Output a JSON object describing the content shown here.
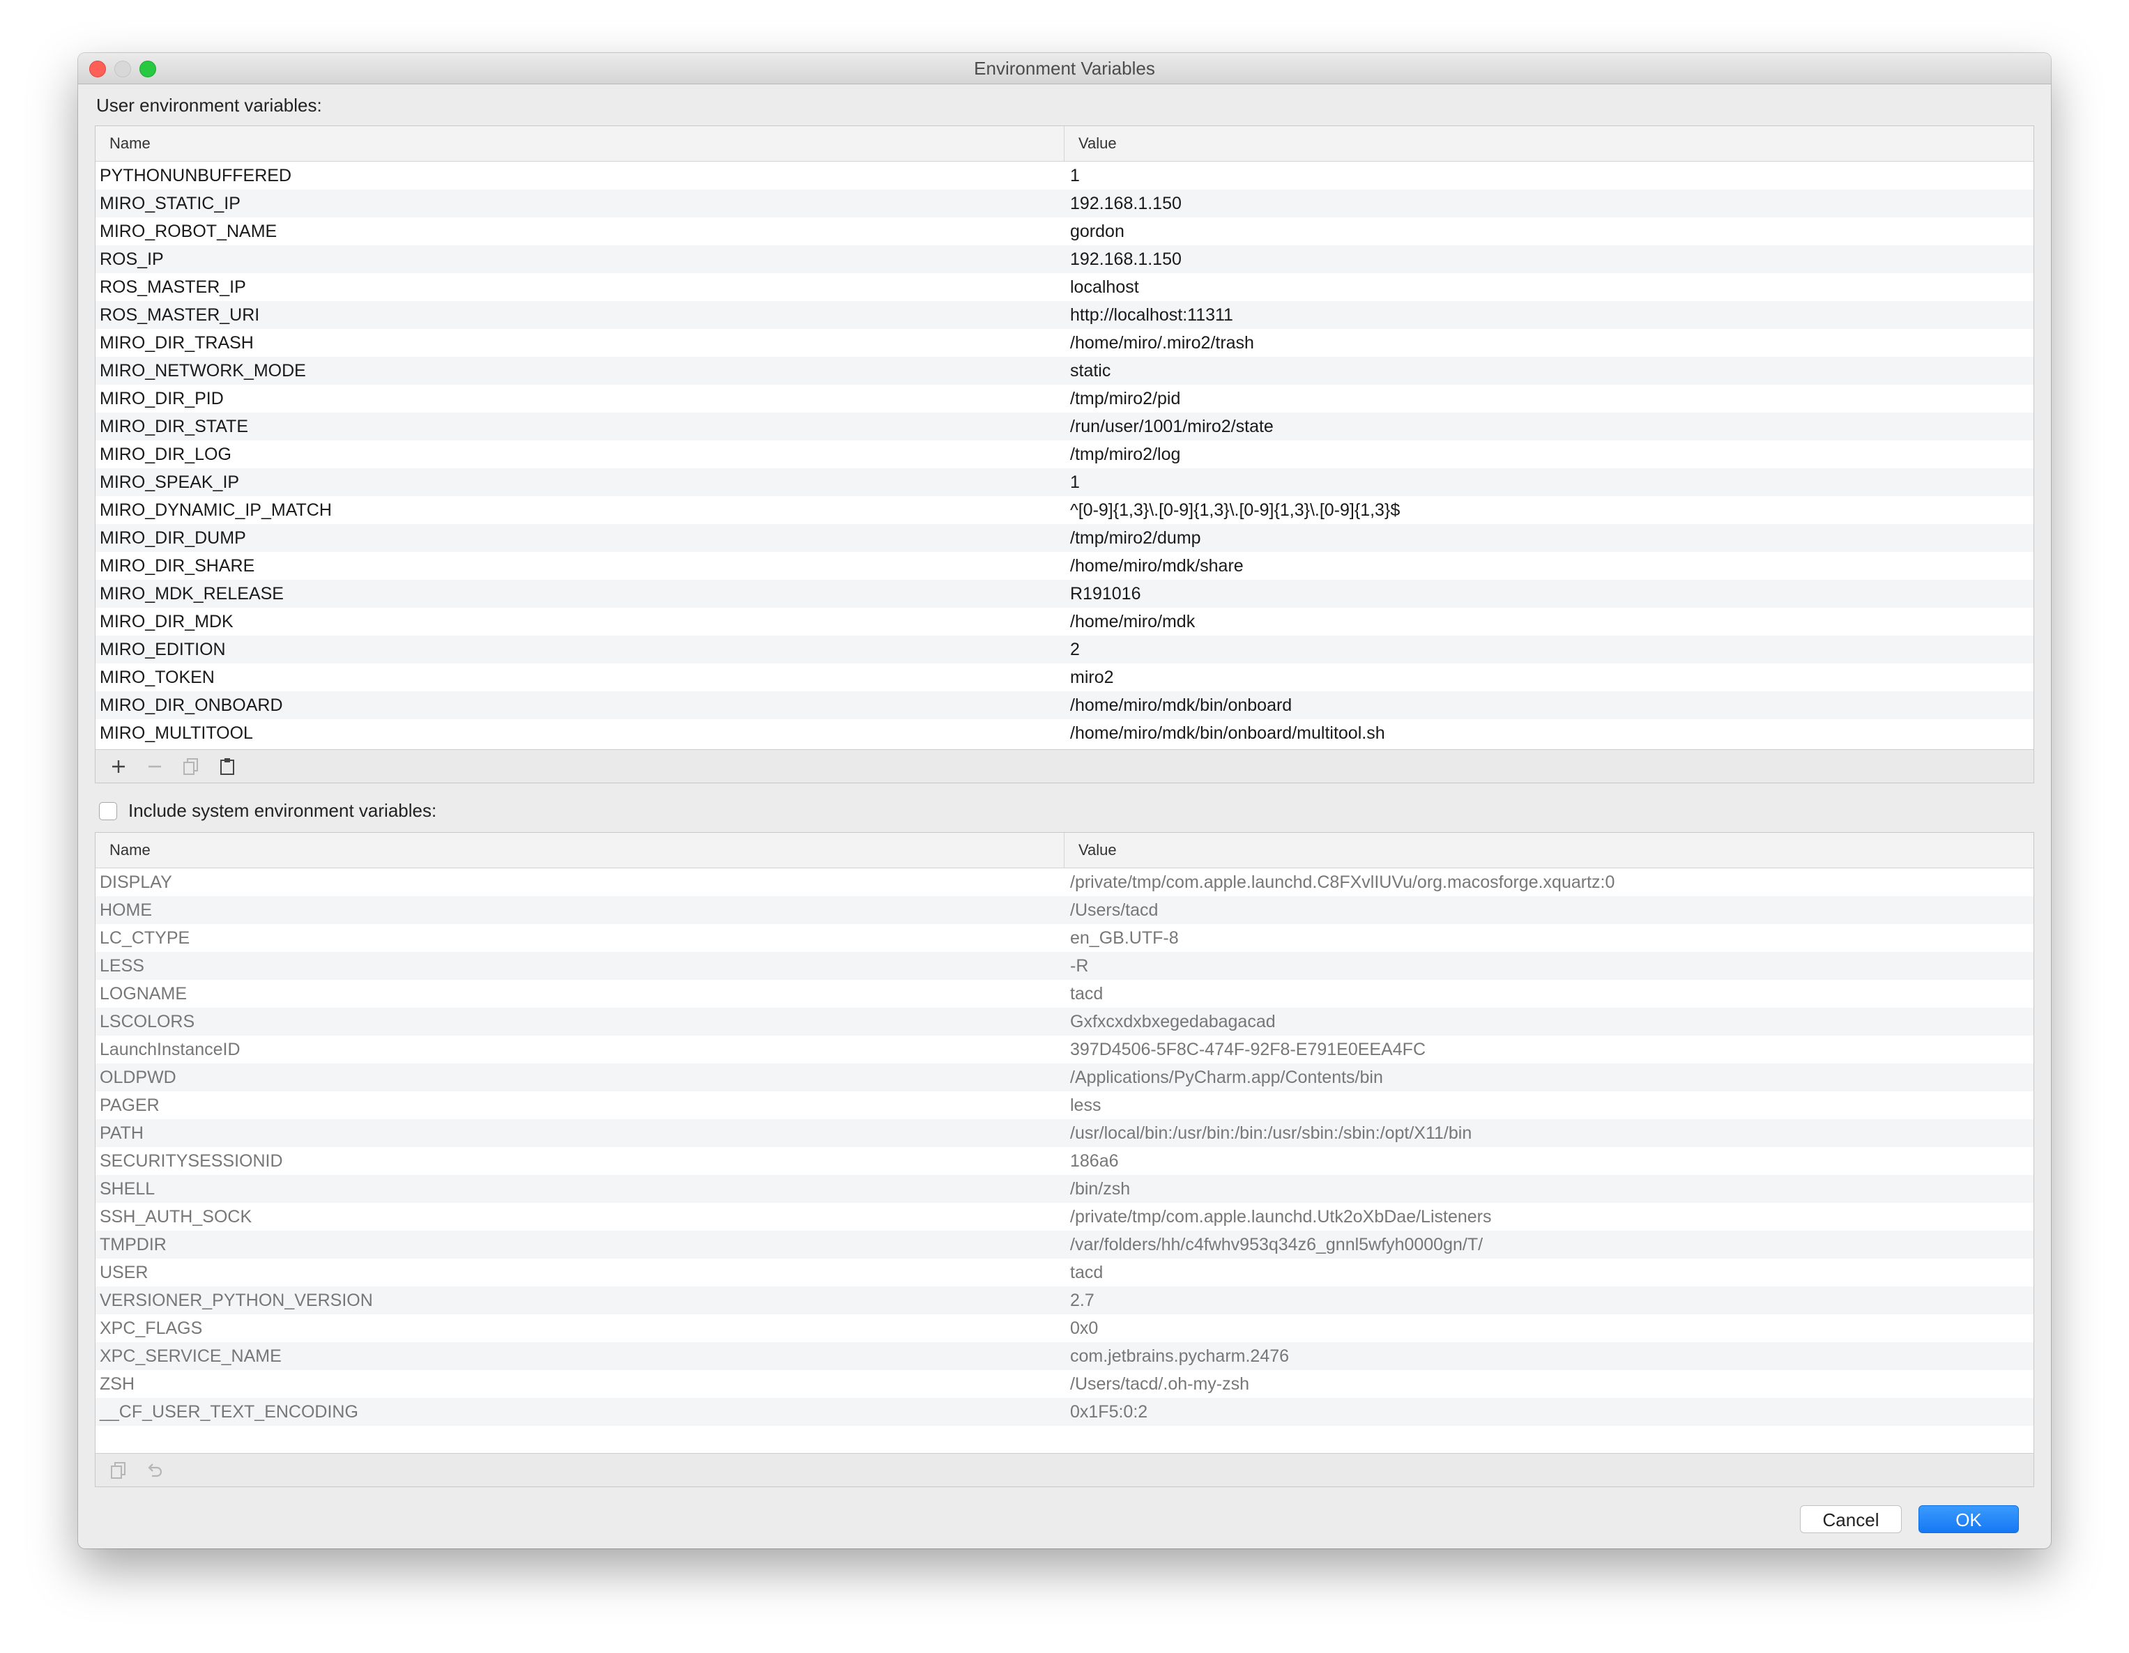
{
  "window": {
    "title": "Environment Variables"
  },
  "user_section": {
    "label": "User environment variables:",
    "columns": {
      "name": "Name",
      "value": "Value"
    },
    "rows": [
      {
        "name": "PYTHONUNBUFFERED",
        "value": "1"
      },
      {
        "name": "MIRO_STATIC_IP",
        "value": "192.168.1.150"
      },
      {
        "name": "MIRO_ROBOT_NAME",
        "value": "gordon"
      },
      {
        "name": "ROS_IP",
        "value": "192.168.1.150"
      },
      {
        "name": "ROS_MASTER_IP",
        "value": "localhost"
      },
      {
        "name": "ROS_MASTER_URI",
        "value": "http://localhost:11311"
      },
      {
        "name": "MIRO_DIR_TRASH",
        "value": "/home/miro/.miro2/trash"
      },
      {
        "name": "MIRO_NETWORK_MODE",
        "value": "static"
      },
      {
        "name": "MIRO_DIR_PID",
        "value": "/tmp/miro2/pid"
      },
      {
        "name": "MIRO_DIR_STATE",
        "value": "/run/user/1001/miro2/state"
      },
      {
        "name": "MIRO_DIR_LOG",
        "value": "/tmp/miro2/log"
      },
      {
        "name": "MIRO_SPEAK_IP",
        "value": "1"
      },
      {
        "name": "MIRO_DYNAMIC_IP_MATCH",
        "value": "^[0-9]{1,3}\\.[0-9]{1,3}\\.[0-9]{1,3}\\.[0-9]{1,3}$"
      },
      {
        "name": "MIRO_DIR_DUMP",
        "value": "/tmp/miro2/dump"
      },
      {
        "name": "MIRO_DIR_SHARE",
        "value": "/home/miro/mdk/share"
      },
      {
        "name": "MIRO_MDK_RELEASE",
        "value": "R191016"
      },
      {
        "name": "MIRO_DIR_MDK",
        "value": "/home/miro/mdk"
      },
      {
        "name": "MIRO_EDITION",
        "value": "2"
      },
      {
        "name": "MIRO_TOKEN",
        "value": "miro2"
      },
      {
        "name": "MIRO_DIR_ONBOARD",
        "value": "/home/miro/mdk/bin/onboard"
      },
      {
        "name": "MIRO_MULTITOOL",
        "value": "/home/miro/mdk/bin/onboard/multitool.sh"
      }
    ],
    "toolbar": {
      "icons": [
        "add-icon",
        "remove-icon",
        "copy-icon",
        "paste-icon"
      ]
    }
  },
  "system_section": {
    "checkbox_label": "Include system environment variables:",
    "checked": false,
    "columns": {
      "name": "Name",
      "value": "Value"
    },
    "rows": [
      {
        "name": "DISPLAY",
        "value": "/private/tmp/com.apple.launchd.C8FXvlIUVu/org.macosforge.xquartz:0"
      },
      {
        "name": "HOME",
        "value": "/Users/tacd"
      },
      {
        "name": "LC_CTYPE",
        "value": "en_GB.UTF-8"
      },
      {
        "name": "LESS",
        "value": "-R"
      },
      {
        "name": "LOGNAME",
        "value": "tacd"
      },
      {
        "name": "LSCOLORS",
        "value": "Gxfxcxdxbxegedabagacad"
      },
      {
        "name": "LaunchInstanceID",
        "value": "397D4506-5F8C-474F-92F8-E791E0EEA4FC"
      },
      {
        "name": "OLDPWD",
        "value": "/Applications/PyCharm.app/Contents/bin"
      },
      {
        "name": "PAGER",
        "value": "less"
      },
      {
        "name": "PATH",
        "value": "/usr/local/bin:/usr/bin:/bin:/usr/sbin:/sbin:/opt/X11/bin"
      },
      {
        "name": "SECURITYSESSIONID",
        "value": "186a6"
      },
      {
        "name": "SHELL",
        "value": "/bin/zsh"
      },
      {
        "name": "SSH_AUTH_SOCK",
        "value": "/private/tmp/com.apple.launchd.Utk2oXbDae/Listeners"
      },
      {
        "name": "TMPDIR",
        "value": "/var/folders/hh/c4fwhv953q34z6_gnnl5wfyh0000gn/T/"
      },
      {
        "name": "USER",
        "value": "tacd"
      },
      {
        "name": "VERSIONER_PYTHON_VERSION",
        "value": "2.7"
      },
      {
        "name": "XPC_FLAGS",
        "value": "0x0"
      },
      {
        "name": "XPC_SERVICE_NAME",
        "value": "com.jetbrains.pycharm.2476"
      },
      {
        "name": "ZSH",
        "value": "/Users/tacd/.oh-my-zsh"
      },
      {
        "name": "__CF_USER_TEXT_ENCODING",
        "value": "0x1F5:0:2"
      }
    ],
    "toolbar": {
      "icons": [
        "copy-icon",
        "undo-icon"
      ]
    }
  },
  "buttons": {
    "cancel": "Cancel",
    "ok": "OK"
  },
  "colors": {
    "accent": "#1578f2",
    "close": "#fe5f57",
    "maximize": "#28c840",
    "system_text": "#777777"
  }
}
